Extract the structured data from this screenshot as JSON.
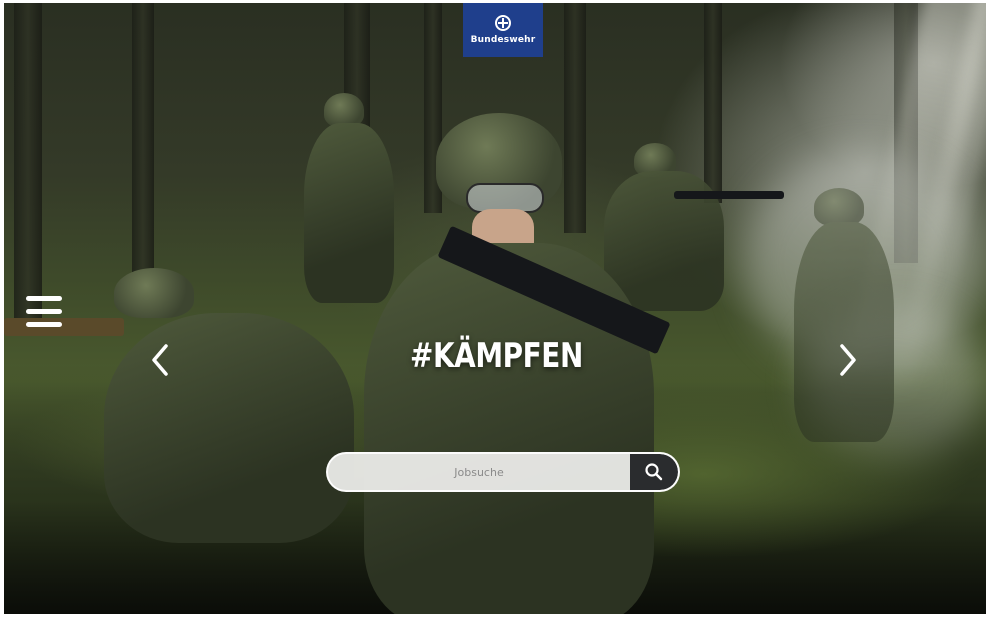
{
  "header": {
    "logo_text": "Bundeswehr",
    "logo_color": "#1f3f8c"
  },
  "navigation": {
    "menu_icon": "hamburger-menu-icon",
    "prev_icon": "chevron-left-icon",
    "next_icon": "chevron-right-icon"
  },
  "hero": {
    "headline": "#KÄMPFEN",
    "background": "forest combat scene with soldiers"
  },
  "search": {
    "placeholder": "Jobsuche",
    "value": "",
    "button_icon": "search-icon",
    "button_color": "#2a2c2e"
  }
}
